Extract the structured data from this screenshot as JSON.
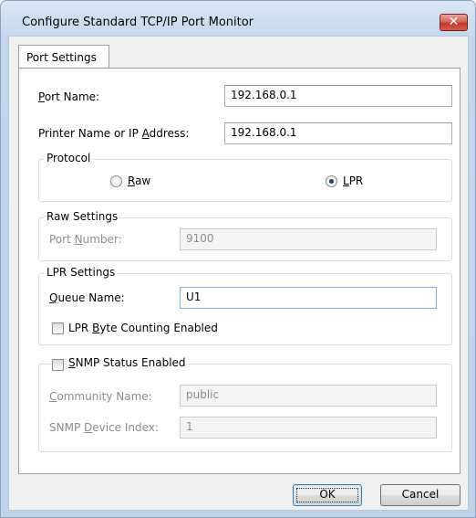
{
  "window": {
    "title": "Configure Standard TCP/IP Port Monitor",
    "close_glyph": "✕"
  },
  "tabs": [
    {
      "label": "Port Settings"
    }
  ],
  "port_name": {
    "label_pre": "",
    "label_u": "P",
    "label_post": "ort Name:",
    "value": "192.168.0.1"
  },
  "printer_name": {
    "label_pre": "Printer Name or IP ",
    "label_u": "A",
    "label_post": "ddress:",
    "value": "192.168.0.1"
  },
  "protocol": {
    "title": "Protocol",
    "raw": {
      "label_u": "R",
      "label_post": "aw",
      "checked": false
    },
    "lpr": {
      "label_u": "L",
      "label_post": "PR",
      "checked": true
    }
  },
  "raw_settings": {
    "title": "Raw Settings",
    "port_number": {
      "label_pre": "Port ",
      "label_u": "N",
      "label_post": "umber:",
      "value": "9100"
    }
  },
  "lpr_settings": {
    "title": "LPR Settings",
    "queue_name": {
      "label_u": "Q",
      "label_post": "ueue Name:",
      "value": "U1"
    },
    "byte_counting": {
      "label_pre": "LPR ",
      "label_u": "B",
      "label_post": "yte Counting Enabled",
      "checked": false
    }
  },
  "snmp": {
    "title_u": "S",
    "title_post": "NMP Status Enabled",
    "checked": false,
    "community": {
      "label_u": "C",
      "label_post": "ommunity Name:",
      "value": "public"
    },
    "device_index": {
      "label_pre": "SNMP ",
      "label_u": "D",
      "label_post": "evice Index:",
      "value": "1"
    }
  },
  "buttons": {
    "ok": "OK",
    "cancel": "Cancel"
  },
  "colors": {
    "accent": "#3c7fb1",
    "disabled_text": "#8d8d8d",
    "close_red": "#c0392b"
  }
}
